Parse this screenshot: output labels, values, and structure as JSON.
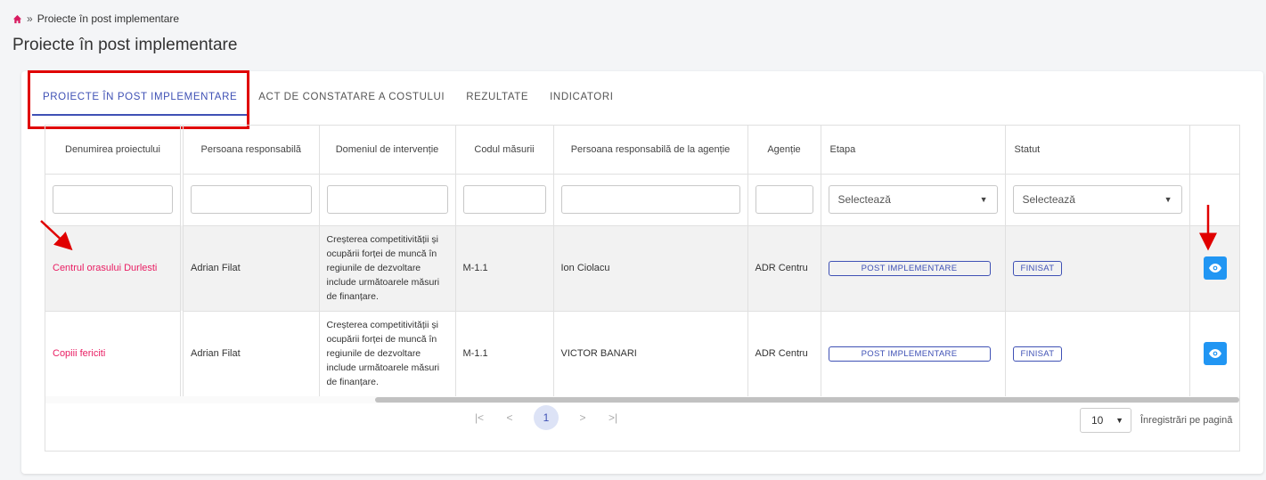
{
  "breadcrumb": {
    "separator": "»",
    "current": "Proiecte în post implementare"
  },
  "page": {
    "title": "Proiecte în post implementare"
  },
  "tabs": [
    {
      "label": "PROIECTE ÎN POST IMPLEMENTARE",
      "active": true
    },
    {
      "label": "ACT DE CONSTATARE A COSTULUI",
      "active": false
    },
    {
      "label": "REZULTATE",
      "active": false
    },
    {
      "label": "INDICATORI",
      "active": false
    }
  ],
  "table": {
    "headers": {
      "name": "Denumirea proiectului",
      "responsible": "Persoana responsabilă",
      "domain": "Domeniul de intervenție",
      "code": "Codul măsurii",
      "agency_person": "Persoana responsabilă de la agenție",
      "agency": "Agenție",
      "stage": "Etapa",
      "status": "Statut"
    },
    "filters": {
      "stage_placeholder": "Selectează",
      "status_placeholder": "Selectează"
    },
    "rows": [
      {
        "name": "Centrul orasului Durlesti",
        "responsible": "Adrian Filat",
        "domain": "Creșterea competitivității și ocupării forței de muncă în regiunile de dezvoltare include următoarele măsuri de finanțare.",
        "code": "M-1.1",
        "agency_person": "Ion Ciolacu",
        "agency": "ADR Centru",
        "stage": "POST IMPLEMENTARE",
        "status": "FINISAT"
      },
      {
        "name": "Copiii fericiti",
        "responsible": "Adrian Filat",
        "domain": "Creșterea competitivității și ocupării forței de muncă în regiunile de dezvoltare include următoarele măsuri de finanțare.",
        "code": "M-1.1",
        "agency_person": "VICTOR BANARI",
        "agency": "ADR Centru",
        "stage": "POST IMPLEMENTARE",
        "status": "FINISAT"
      }
    ]
  },
  "pagination": {
    "first": "|<",
    "prev": "<",
    "current_page": "1",
    "next": ">",
    "last": ">|",
    "per_page_value": "10",
    "per_page_label": "Înregistrări pe pagină"
  },
  "colors": {
    "accent": "#3f51b5",
    "link": "#e91e63",
    "button": "#2196f3",
    "annotation": "#e00000"
  }
}
